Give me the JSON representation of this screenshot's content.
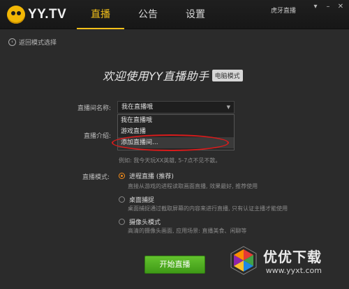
{
  "app": {
    "logo_text": "YY.TV"
  },
  "nav": {
    "tabs": [
      "直播",
      "公告",
      "设置"
    ]
  },
  "account": {
    "name": "虎牙直播"
  },
  "back": {
    "label": "返回模式选择"
  },
  "heading": {
    "title": "欢迎使用YY直播助手",
    "badge": "电脑模式"
  },
  "form": {
    "room_name_label": "直播间名称:",
    "room_name_value": "我在直播哦",
    "dropdown_options": [
      "我在直播哦",
      "游戏直播",
      "添加直播间..."
    ],
    "intro_label": "直播介绍:",
    "intro_example": "例如: 我今天玩XX英雄, 5-7点不见不散。",
    "mode_label": "直播模式:",
    "modes": [
      {
        "label": "进程直播 (推荐)",
        "desc": "直接从游戏的进程读取画面直播, 效果最好, 推荐使用",
        "selected": true
      },
      {
        "label": "桌面捕捉",
        "desc": "桌面捕捉通过截取屏幕的内容来进行直播, 只有认证主播才能使用",
        "selected": false
      },
      {
        "label": "摄像头模式",
        "desc": "高清的摄像头画面, 应用场景: 直播美食、闲聊等",
        "selected": false
      }
    ]
  },
  "start_button": {
    "label": "开始直播"
  },
  "watermark": {
    "title": "优优下载",
    "url": "www.yyxt.com"
  },
  "colors": {
    "accent": "#f3c01a",
    "radio_on": "#f08a1a",
    "start_green": "#4caf1f",
    "highlight_red": "#d81b1b"
  }
}
